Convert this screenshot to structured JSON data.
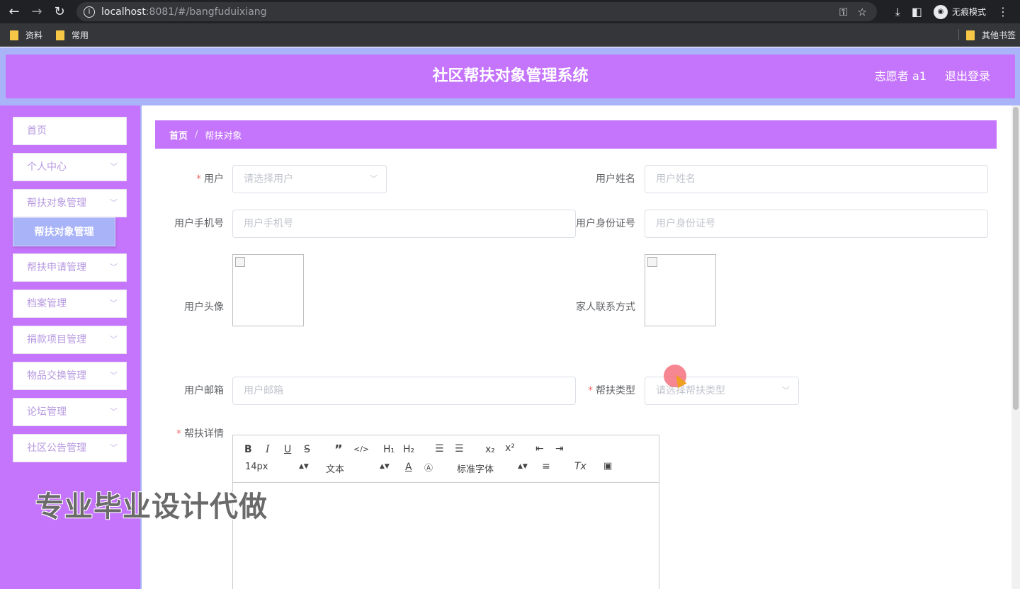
{
  "browser": {
    "url_host": "localhost",
    "url_rest": ":8081/#/bangfuduixiang",
    "incognito_label": "无痕模式",
    "bookmarks": [
      "资料",
      "常用"
    ],
    "other_bookmarks": "其他书签"
  },
  "header": {
    "title": "社区帮扶对象管理系统",
    "user": "志愿者 a1",
    "logout": "退出登录"
  },
  "sidebar": {
    "items": [
      {
        "label": "首页",
        "has_arrow": false
      },
      {
        "label": "个人中心",
        "has_arrow": true
      },
      {
        "label": "帮扶对象管理",
        "has_arrow": true
      },
      {
        "label": "帮扶申请管理",
        "has_arrow": true
      },
      {
        "label": "档案管理",
        "has_arrow": true
      },
      {
        "label": "捐款项目管理",
        "has_arrow": true
      },
      {
        "label": "物品交换管理",
        "has_arrow": true
      },
      {
        "label": "论坛管理",
        "has_arrow": true
      },
      {
        "label": "社区公告管理",
        "has_arrow": true
      }
    ],
    "submenu_active": "帮扶对象管理"
  },
  "breadcrumb": {
    "home": "首页",
    "separator": "/",
    "current": "帮扶对象"
  },
  "form": {
    "user": {
      "label": "用户",
      "placeholder": "请选择用户",
      "required": true
    },
    "user_name": {
      "label": "用户姓名",
      "placeholder": "用户姓名"
    },
    "user_phone": {
      "label": "用户手机号",
      "placeholder": "用户手机号"
    },
    "user_id_card": {
      "label": "用户身份证号",
      "placeholder": "用户身份证号"
    },
    "user_avatar": {
      "label": "用户头像"
    },
    "family_contact": {
      "label": "家人联系方式"
    },
    "user_email": {
      "label": "用户邮箱",
      "placeholder": "用户邮箱"
    },
    "aid_type": {
      "label": "帮扶类型",
      "placeholder": "请选择帮扶类型",
      "required": true
    },
    "aid_detail": {
      "label": "帮扶详情",
      "required": true
    }
  },
  "editor": {
    "font_size": "14px",
    "paragraph": "文本",
    "font_family": "标准字体"
  },
  "watermark": "专业毕业设计代做",
  "colors": {
    "header_bg": "#c575fc",
    "app_bg": "#a9b4f8",
    "required": "#f56c6c"
  }
}
